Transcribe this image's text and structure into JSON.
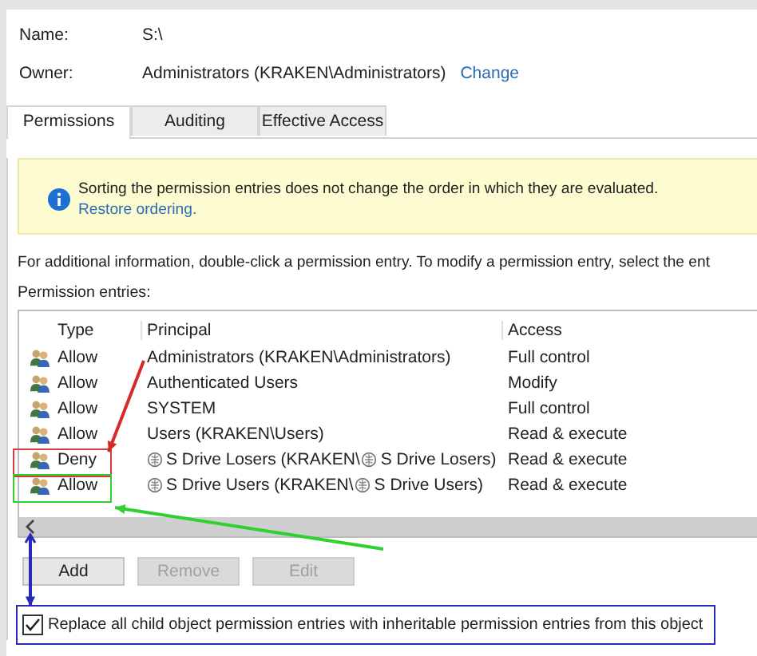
{
  "fields": [
    {
      "label": "Name:",
      "value": "S:\\"
    },
    {
      "label": "Owner:",
      "value": "Administrators (KRAKEN\\Administrators)",
      "link": "Change"
    }
  ],
  "tabs": [
    {
      "label": "Permissions",
      "selected": true
    },
    {
      "label": "Auditing",
      "selected": false
    },
    {
      "label": "Effective Access",
      "selected": false
    }
  ],
  "notice": {
    "text": "Sorting the permission entries does not change the order in which they are evaluated.",
    "link": "Restore ordering."
  },
  "instructions": "For additional information, double-click a permission entry. To modify a permission entry, select the ent",
  "entries_label": "Permission entries:",
  "table": {
    "columns": [
      "Type",
      "Principal",
      "Access"
    ],
    "rows": [
      {
        "type": "Allow",
        "principal": [
          {
            "kind": "plain",
            "text": "Administrators (KRAKEN\\Administrators)"
          }
        ],
        "access": "Full control"
      },
      {
        "type": "Allow",
        "principal": [
          {
            "kind": "plain",
            "text": "Authenticated Users"
          }
        ],
        "access": "Modify"
      },
      {
        "type": "Allow",
        "principal": [
          {
            "kind": "plain",
            "text": "SYSTEM"
          }
        ],
        "access": "Full control"
      },
      {
        "type": "Allow",
        "principal": [
          {
            "kind": "plain",
            "text": "Users (KRAKEN\\Users)"
          }
        ],
        "access": "Read & execute"
      },
      {
        "type": "Deny",
        "principal": [
          {
            "kind": "group",
            "text": "S Drive Losers (KRAKEN\\"
          },
          {
            "kind": "group",
            "text": "S Drive Losers)"
          }
        ],
        "access": "Read & execute"
      },
      {
        "type": "Allow",
        "principal": [
          {
            "kind": "group",
            "text": "S Drive Users (KRAKEN\\"
          },
          {
            "kind": "group",
            "text": "S Drive Users)"
          }
        ],
        "access": "Read & execute"
      }
    ]
  },
  "buttons": [
    {
      "label": "Add",
      "disabled": false
    },
    {
      "label": "Remove",
      "disabled": true
    },
    {
      "label": "Edit",
      "disabled": true
    }
  ],
  "replace_checkbox": {
    "label": "Replace all child object permission entries with inheritable permission entries from this object",
    "checked": true
  },
  "annotations": [
    {
      "kind": "box",
      "color": "#d23c3c"
    },
    {
      "kind": "arrow",
      "color": "#d42a2a"
    },
    {
      "kind": "box",
      "color": "#2ed12e"
    },
    {
      "kind": "arrow",
      "color": "#2ed12e"
    },
    {
      "kind": "arrow",
      "color": "#2a2ab8"
    },
    {
      "kind": "box",
      "color": "#2a2ab8"
    }
  ]
}
